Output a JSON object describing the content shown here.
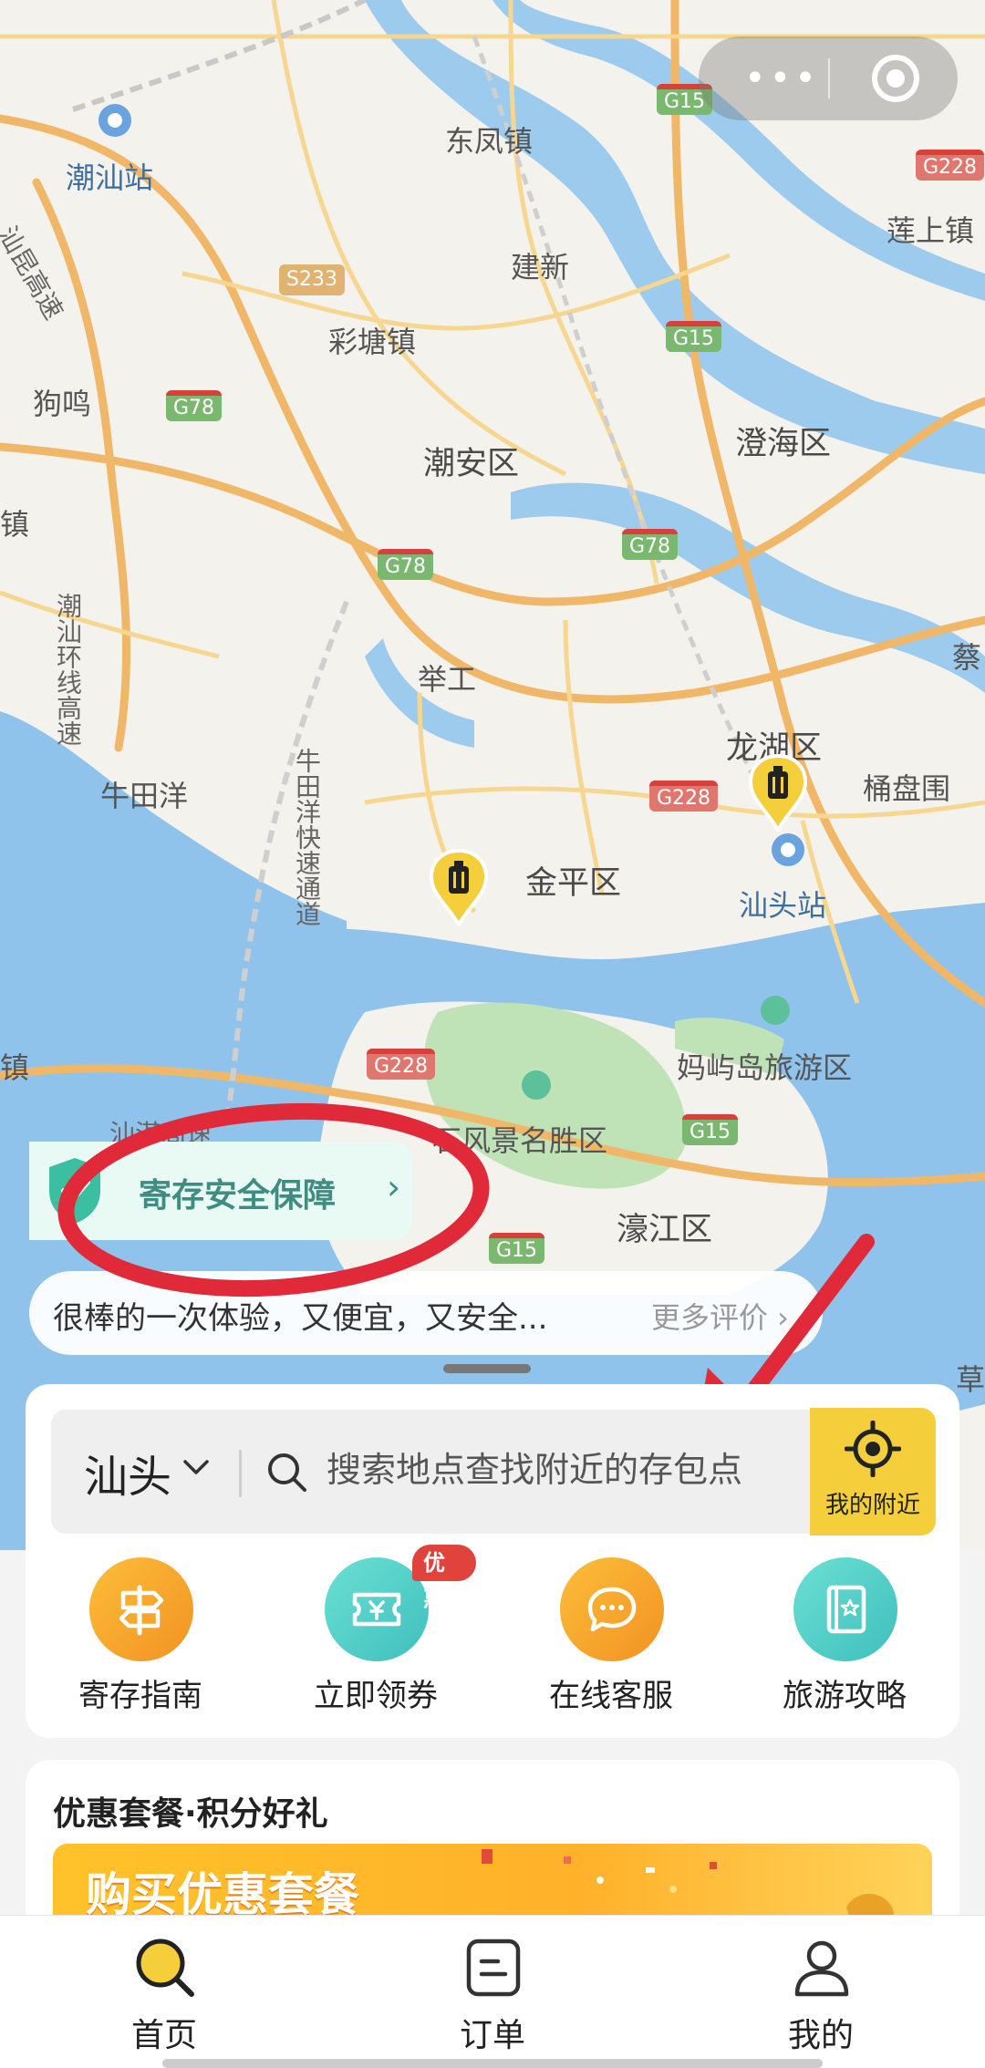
{
  "map": {
    "places": {
      "chaoshan_station": "潮汕站",
      "dongfeng": "东凤镇",
      "jianxin": "建新",
      "caitang": "彩塘镇",
      "liansheng": "莲上镇",
      "gouming": "狗鸣",
      "chaoan": "潮安区",
      "chenghai": "澄海区",
      "zhen_left": "镇",
      "jugong": "举工",
      "longhu": "龙湖区",
      "niutianyang": "牛田洋",
      "tongpanwei": "桶盘围",
      "jinping": "金平区",
      "shantou_station": "汕头站",
      "mayu": "妈屿岛旅游区",
      "scenic": "石风景名胜区",
      "haojiang": "濠江区",
      "zhen_left2": "镇",
      "cao_right": "草",
      "cai_right": "蔡"
    },
    "roads": {
      "g15": "G15",
      "g228": "G228",
      "s233": "S233",
      "g78": "G78",
      "expressway_v": "牛田洋快速通道",
      "expressway_sw": "汕湛高速",
      "expressway_nw": "汕昆高速",
      "expressway_w": "潮汕环线高速"
    }
  },
  "capsule": {
    "more_label": "•••",
    "close_icon": "target-icon"
  },
  "safety_banner": {
    "label": "寄存安全保障",
    "chevron": "›"
  },
  "review": {
    "text": "很棒的一次体验，又便宜，又安全...",
    "more": "更多评价 ›"
  },
  "search": {
    "city": "汕头",
    "placeholder": "搜索地点查找附近的存包点",
    "nearby_label": "我的附近"
  },
  "quick_actions": [
    {
      "label": "寄存指南",
      "icon": "signpost-icon"
    },
    {
      "label": "立即领券",
      "icon": "coupon-icon",
      "badge": "优惠"
    },
    {
      "label": "在线客服",
      "icon": "chat-icon"
    },
    {
      "label": "旅游攻略",
      "icon": "guidebook-icon"
    }
  ],
  "promo": {
    "title": "优惠套餐·积分好礼",
    "banner_text": "购买优惠套餐"
  },
  "tabs": [
    {
      "label": "首页",
      "icon": "search-icon",
      "active": true
    },
    {
      "label": "订单",
      "icon": "order-icon",
      "active": false
    },
    {
      "label": "我的",
      "icon": "user-icon",
      "active": false
    }
  ],
  "colors": {
    "accent": "#f4cf3b",
    "teal": "#3f8c82",
    "annotation_red": "#e02a3a",
    "water": "#8fc3ec"
  }
}
